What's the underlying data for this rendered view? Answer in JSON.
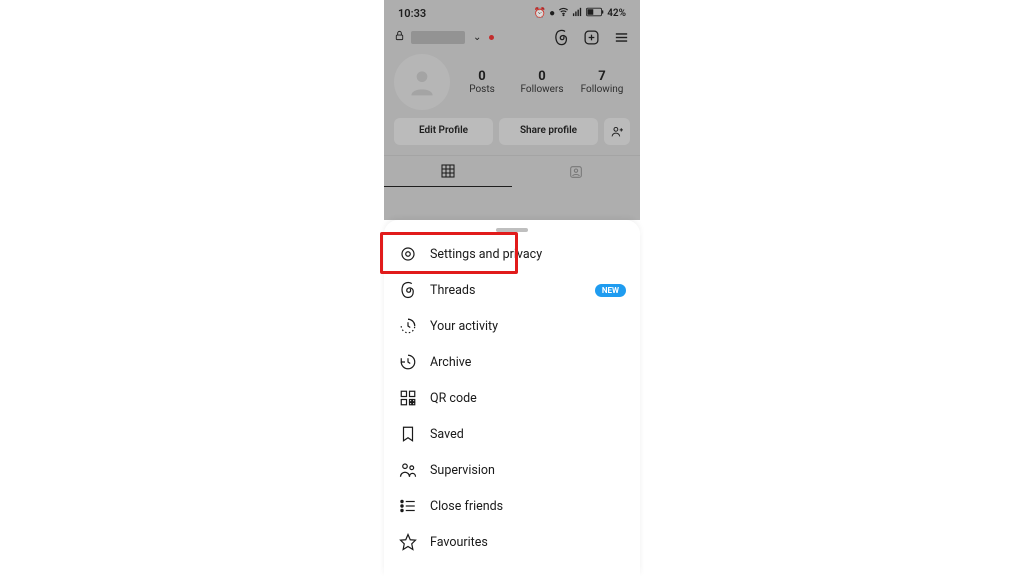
{
  "status": {
    "time": "10:33",
    "battery": "42%"
  },
  "profile": {
    "stats": [
      {
        "num": "0",
        "label": "Posts"
      },
      {
        "num": "0",
        "label": "Followers"
      },
      {
        "num": "7",
        "label": "Following"
      }
    ],
    "edit_btn": "Edit Profile",
    "share_btn": "Share profile"
  },
  "menu": {
    "items": [
      {
        "label": "Settings and privacy",
        "icon": "settings",
        "highlight": true
      },
      {
        "label": "Threads",
        "icon": "threads",
        "badge": "NEW"
      },
      {
        "label": "Your activity",
        "icon": "activity"
      },
      {
        "label": "Archive",
        "icon": "archive"
      },
      {
        "label": "QR code",
        "icon": "qr"
      },
      {
        "label": "Saved",
        "icon": "saved"
      },
      {
        "label": "Supervision",
        "icon": "supervision"
      },
      {
        "label": "Close friends",
        "icon": "closefriends"
      },
      {
        "label": "Favourites",
        "icon": "star"
      }
    ]
  }
}
